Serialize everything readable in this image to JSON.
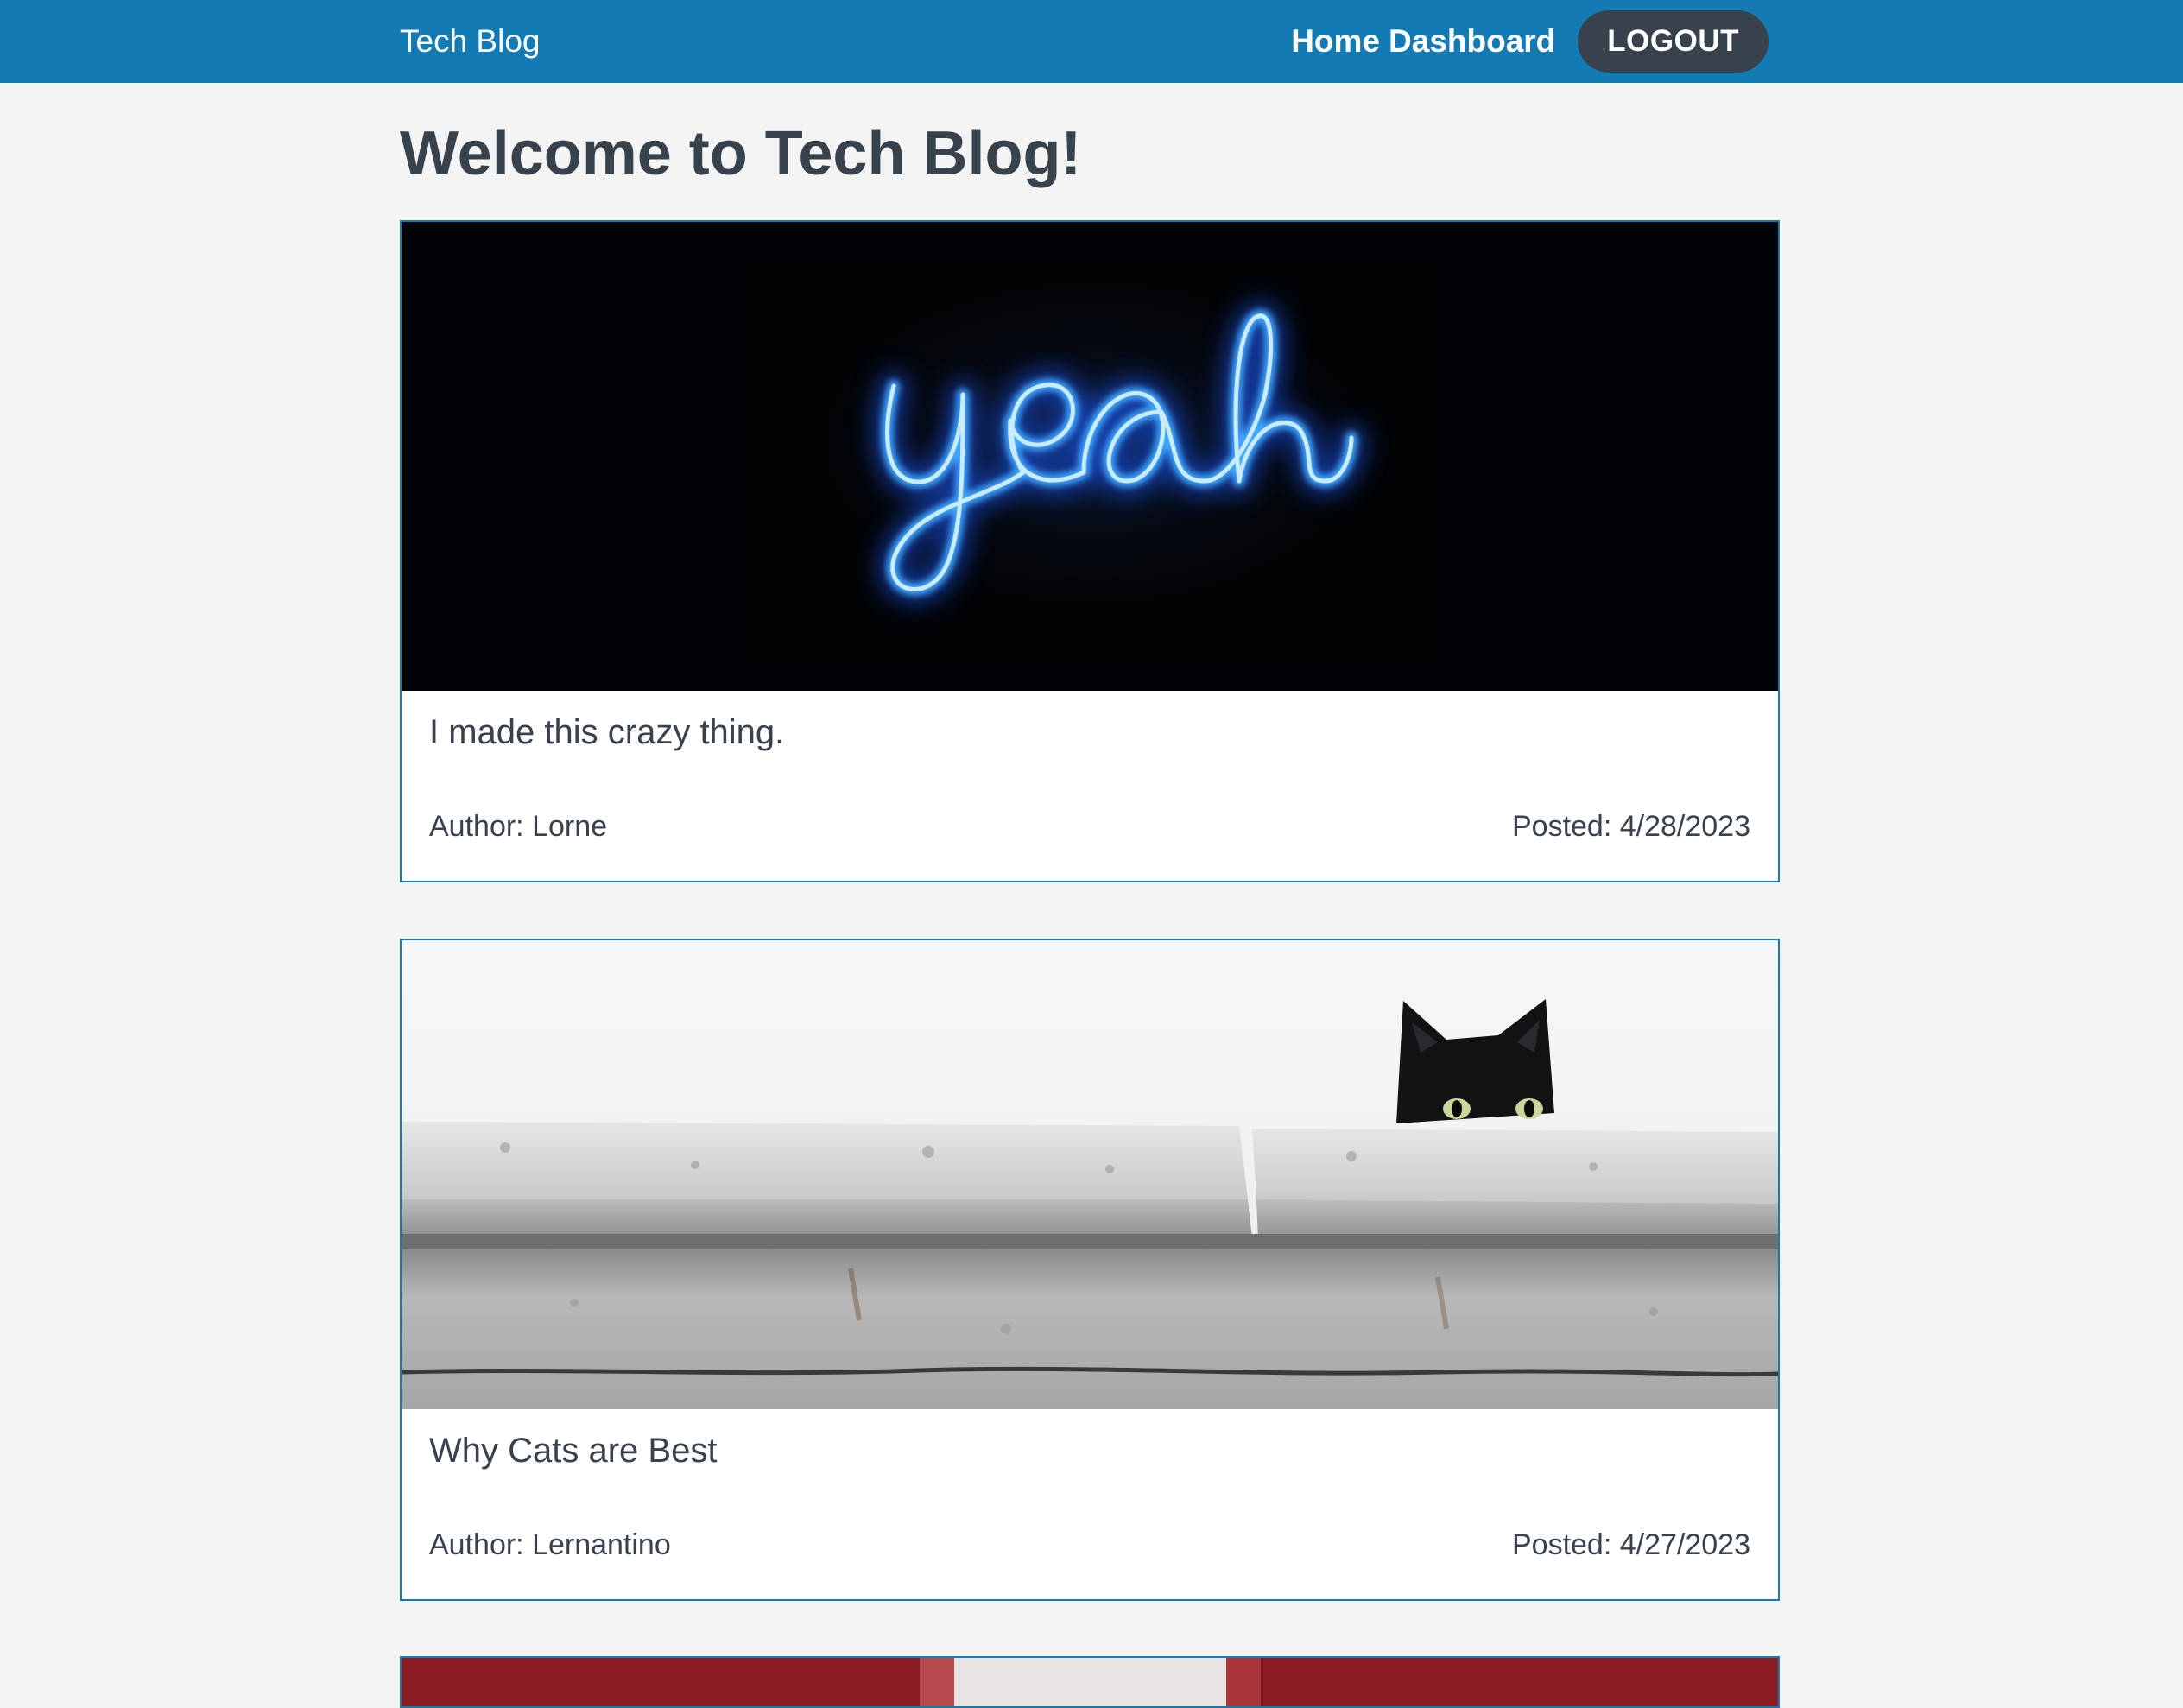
{
  "navbar": {
    "brand": "Tech Blog",
    "links": {
      "home": "Home",
      "dashboard": "Dashboard"
    },
    "logout_label": "LOGOUT",
    "background_color": "#137ab4"
  },
  "page": {
    "title": "Welcome to Tech Blog!"
  },
  "posts": [
    {
      "title": "I made this crazy thing.",
      "author": "Author: Lorne",
      "posted": "Posted: 4/28/2023",
      "image": "neon-yeah-sign-photo"
    },
    {
      "title": "Why Cats are Best",
      "author": "Author: Lernantino",
      "posted": "Posted: 4/27/2023",
      "image": "black-cat-peeking-over-wall-photo"
    },
    {
      "image": "red-curtain-photo"
    }
  ],
  "colors": {
    "accent": "#137ab4",
    "text": "#37424d",
    "background": "#f4f4f4",
    "button": "#37424d"
  }
}
